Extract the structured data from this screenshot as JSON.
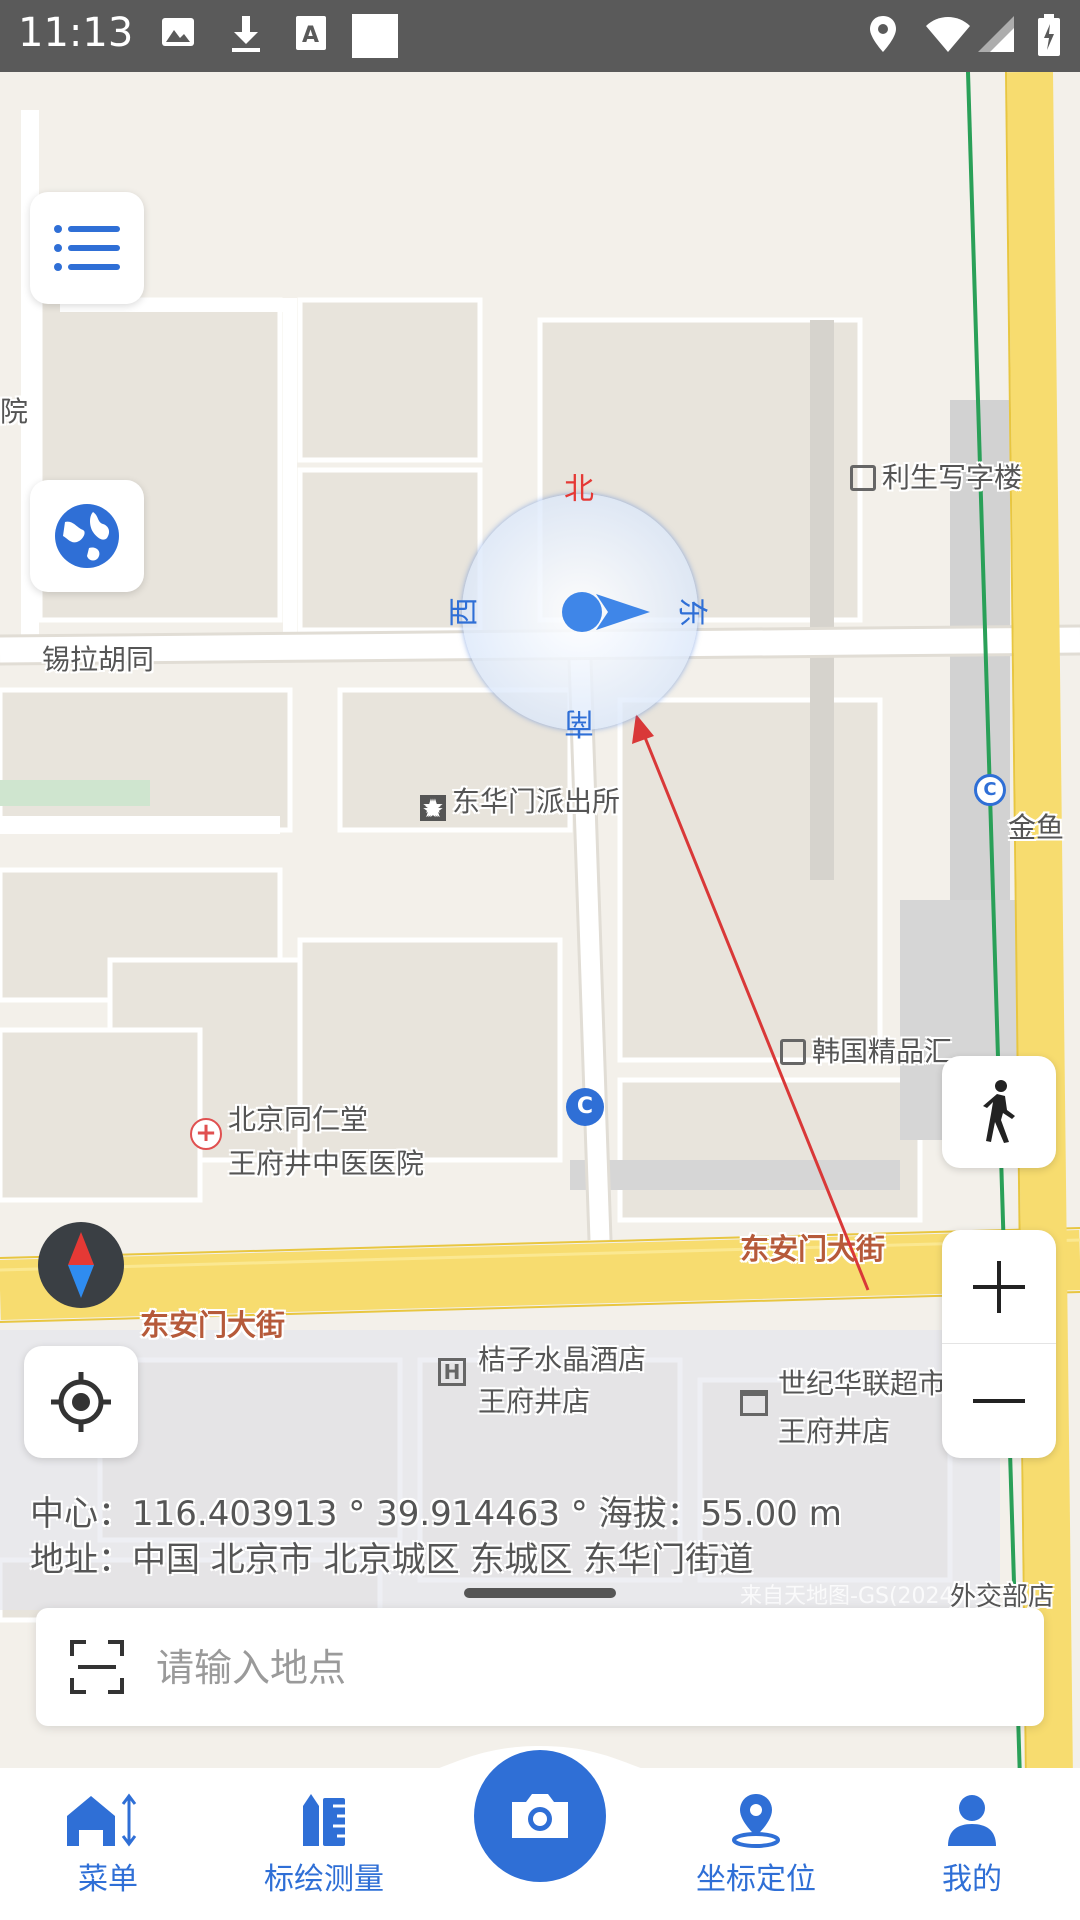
{
  "status_bar": {
    "time": "11:13",
    "left_icons": [
      "image-icon",
      "download-icon",
      "a-icon",
      "square-icon"
    ],
    "right_icons": [
      "location-icon",
      "wifi-icon",
      "signal-icon",
      "battery-icon"
    ]
  },
  "map": {
    "labels": [
      {
        "text": "锡拉胡同",
        "type": "street"
      },
      {
        "text": "利生写字楼",
        "type": "poi"
      },
      {
        "text": "东华门派出所",
        "type": "poi"
      },
      {
        "text": "金鱼",
        "type": "poi"
      },
      {
        "text": "韩国精品汇",
        "type": "poi"
      },
      {
        "text": "北京同仁堂",
        "type": "poi"
      },
      {
        "text": "王府井中医医院",
        "type": "poi"
      },
      {
        "text": "东安门大街",
        "type": "road"
      },
      {
        "text": "东安门大街",
        "type": "road"
      },
      {
        "text": "桔子水晶酒店",
        "type": "poi"
      },
      {
        "text": "王府井店",
        "type": "poi"
      },
      {
        "text": "世纪华联超市",
        "type": "poi"
      },
      {
        "text": "王府井店",
        "type": "poi"
      },
      {
        "text": "院",
        "type": "poi"
      }
    ],
    "compass_rose": {
      "north": "北",
      "south": "南",
      "east": "东",
      "west": "西"
    },
    "attribution": "来自天地图-GS(2024)",
    "attribution_poi": "外交部店"
  },
  "info": {
    "center_line": "中心：116.403913 ° 39.914463 ° 海拔：55.00 m",
    "address_line": "地址：中国 北京市 北京城区 东城区 东华门街道"
  },
  "search": {
    "placeholder": "请输入地点"
  },
  "bottom_nav": {
    "items": [
      {
        "label": "菜单",
        "icon": "home-icon"
      },
      {
        "label": "标绘测量",
        "icon": "ruler-icon"
      },
      {
        "label": "坐标定位",
        "icon": "location-pin-icon"
      },
      {
        "label": "我的",
        "icon": "user-icon"
      }
    ],
    "camera_icon": "camera-icon"
  },
  "colors": {
    "primary": "#2F6FD6",
    "road_yellow": "#F7DC6F",
    "map_bg": "#F3F0EA",
    "arrow_red": "#D93838",
    "north_red": "#E53935"
  }
}
